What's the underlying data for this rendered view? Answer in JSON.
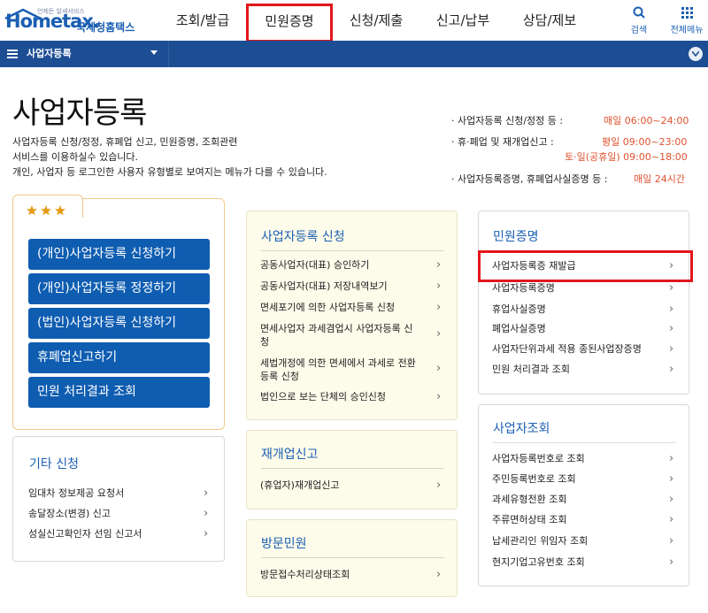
{
  "header": {
    "logo_tagline": "언제든 알세서비스",
    "logo_brand": "Hometax.",
    "logo_sub": "국세청홈택스",
    "nav": [
      "조회/발급",
      "민원증명",
      "신청/제출",
      "신고/납부",
      "상담/제보"
    ],
    "search_label": "검색",
    "allmenu_label": "전체메뉴"
  },
  "subnav": {
    "title": "사업자등록"
  },
  "page": {
    "title": "사업자등록",
    "desc": [
      "사업자등록 신청/정정, 휴폐업 신고, 민원증명, 조회관련",
      "서비스를 이용하실수 있습니다.",
      "개인, 사업자 등 로그인한 사용자 유형별로 보여지는 메뉴가 다를 수 있습니다."
    ]
  },
  "hours": [
    {
      "label": "· 사업자등록 신청/정정 등 :",
      "value": "매일 06:00~24:00"
    },
    {
      "label": "· 휴·폐업 및 재개업신고 :",
      "value": "평일 09:00~23:00"
    },
    {
      "label": "",
      "value": "토·일(공휴일) 09:00~18:00"
    },
    {
      "label": "· 사업자등록증명, 휴폐업사실증명 등 :",
      "value": "매일 24시간"
    }
  ],
  "quick": {
    "buttons": [
      "(개인)사업자등록 신청하기",
      "(개인)사업자등록 정정하기",
      "(법인)사업자등록 신청하기",
      "휴폐업신고하기",
      "민원 처리결과 조회"
    ]
  },
  "etc": {
    "title": "기타 신청",
    "items": [
      "임대차 정보제공 요청서",
      "송달장소(변경) 신고",
      "성실신고확인자 선임 신고서"
    ]
  },
  "register": {
    "title": "사업자등록 신청",
    "items": [
      [
        "공동사업자(대표) 승인하기"
      ],
      [
        "공동사업자(대표) 저장내역보기"
      ],
      [
        "면세포기에 의한 사업자등록 신청"
      ],
      [
        "면세사업자 과세겸업시 사업자등록 신",
        "청"
      ],
      [
        "세법개정에 의한 면세에서 과세로 전환",
        "등록 신청"
      ],
      [
        "법인으로 보는 단체의 승인신청"
      ]
    ]
  },
  "reopen": {
    "title": "재개업신고",
    "items": [
      "(휴업자)재개업신고"
    ]
  },
  "visit": {
    "title": "방문민원",
    "items": [
      "방문접수처리상태조회"
    ]
  },
  "certificate": {
    "title": "민원증명",
    "items": [
      "사업자등록증 재발급",
      "사업자등록증명",
      "휴업사실증명",
      "폐업사실증명",
      "사업자단위과세 적용 종된사업장증명",
      "민원 처리결과 조회"
    ]
  },
  "lookup": {
    "title": "사업자조회",
    "items": [
      "사업자등록번호로 조회",
      "주민등록번호로 조회",
      "과세유형전환 조회",
      "주류면허상태 조회",
      "납세관리인 위임자 조회",
      "현지기업고유번호 조회"
    ]
  },
  "chevron": "›",
  "colors": {
    "primary": "#1b5fb2",
    "button": "#0f5db1",
    "subnav": "#1d4e94",
    "highlight": "#e2161b",
    "accent_time": "#e0522f"
  }
}
